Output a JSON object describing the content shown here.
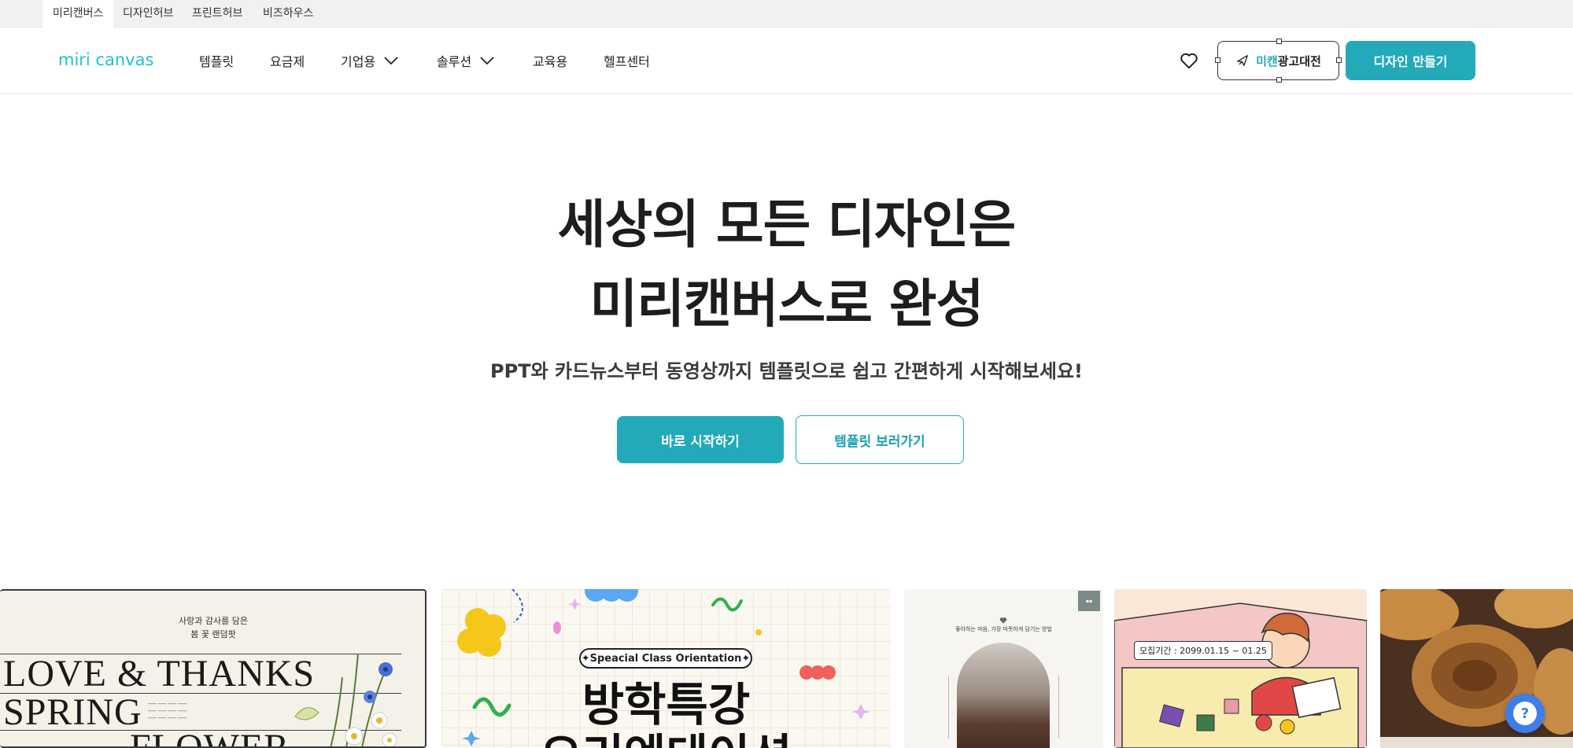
{
  "utility_tabs": [
    {
      "label": "미리캔버스",
      "active": true
    },
    {
      "label": "디자인허브",
      "active": false
    },
    {
      "label": "프린트허브",
      "active": false
    },
    {
      "label": "비즈하우스",
      "active": false
    }
  ],
  "header": {
    "logo_text": "miri canvas",
    "nav": [
      {
        "label": "템플릿",
        "has_dropdown": false
      },
      {
        "label": "요금제",
        "has_dropdown": false
      },
      {
        "label": "기업용",
        "has_dropdown": true
      },
      {
        "label": "솔루션",
        "has_dropdown": true
      },
      {
        "label": "교육용",
        "has_dropdown": false
      },
      {
        "label": "헬프센터",
        "has_dropdown": false
      }
    ],
    "promo_prefix": "미캔",
    "promo_suffix": "광고대전",
    "cta_label": "디자인 만들기",
    "icons": {
      "wishlist": "heart-icon",
      "promo": "rocket-icon",
      "dropdown": "chevron-down-icon"
    }
  },
  "hero": {
    "title_line1": "세상의 모든 디자인은",
    "title_line2": "미리캔버스로 완성",
    "subtitle": "PPT와 카드뉴스부터 동영상까지 템플릿으로 쉽고 간편하게 시작해보세요!",
    "primary_button": "바로 시작하기",
    "secondary_button": "템플릿 보러가기"
  },
  "templates": {
    "card1": {
      "small_line1": "사랑과 감사를 담은",
      "small_line2": "봄 꽃 랜덤팟",
      "line1": "LOVE & THANKS",
      "line2": "SPRING",
      "line3": "FLOWER"
    },
    "card2": {
      "pill": "✦Speacial Class Orientation✦",
      "line1": "방학특강",
      "line2": "오리엔테이션"
    },
    "card3": {
      "caption": "좋아하는 마음, 가장 따뜻하게 담기는 방법"
    },
    "card4": {
      "label": "모집기간 : 2099.01.15 ~ 01.25"
    }
  },
  "help_button": "?",
  "colors": {
    "brand": "#22aab9",
    "logo": "#1fc1cf",
    "help": "#3f7de8"
  }
}
